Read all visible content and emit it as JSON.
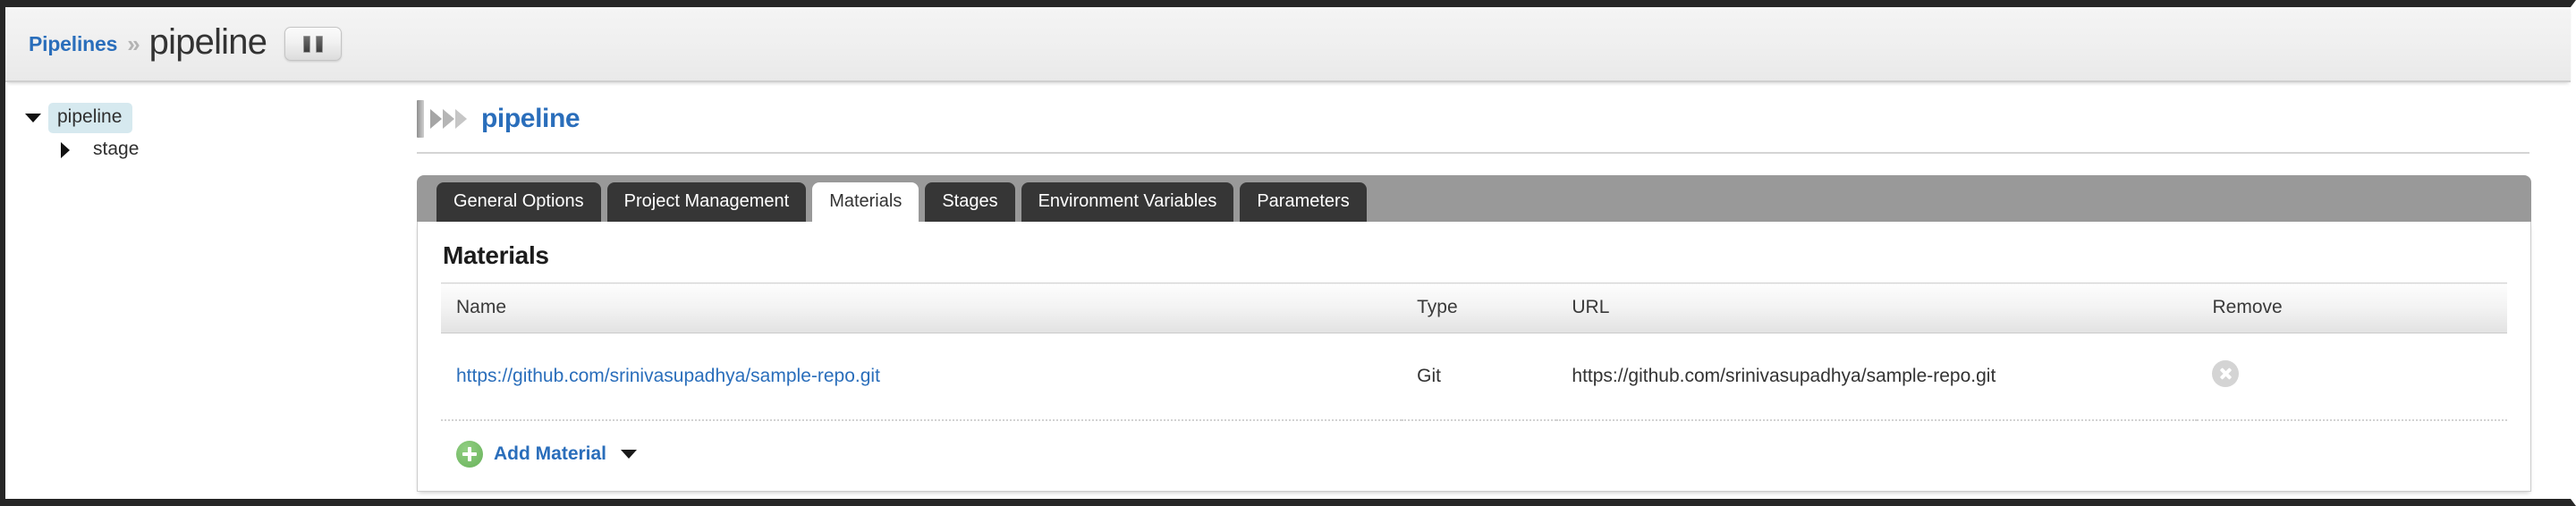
{
  "header": {
    "breadcrumb_root": "Pipelines",
    "breadcrumb_separator": "»",
    "breadcrumb_current": "pipeline",
    "pause_button_label": "Pause"
  },
  "sidebar": {
    "items": [
      {
        "label": "pipeline",
        "level": 0,
        "expanded": true,
        "selected": true
      },
      {
        "label": "stage",
        "level": 1,
        "expanded": false,
        "selected": false
      }
    ]
  },
  "main": {
    "pipeline_title": "pipeline",
    "tabs": [
      {
        "label": "General Options",
        "active": false
      },
      {
        "label": "Project Management",
        "active": false
      },
      {
        "label": "Materials",
        "active": true
      },
      {
        "label": "Stages",
        "active": false
      },
      {
        "label": "Environment Variables",
        "active": false
      },
      {
        "label": "Parameters",
        "active": false
      }
    ],
    "panel": {
      "heading": "Materials",
      "columns": [
        "Name",
        "Type",
        "URL",
        "Remove"
      ],
      "rows": [
        {
          "name": "https://github.com/srinivasupadhya/sample-repo.git",
          "type": "Git",
          "url": "https://github.com/srinivasupadhya/sample-repo.git",
          "remove_icon": "remove-circle-icon"
        }
      ],
      "add_material_label": "Add Material"
    }
  },
  "colors": {
    "link_blue": "#2a6ebb",
    "tab_bar_grey": "#999999",
    "tab_inactive": "#363636",
    "tree_selected": "#d6e9ef",
    "add_green": "#68b25a"
  }
}
